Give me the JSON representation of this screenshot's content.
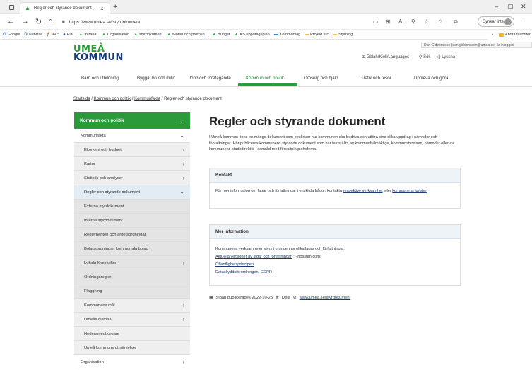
{
  "browser": {
    "tab_title": "Regler och styrande dokument -",
    "tab_close": "×",
    "new_tab": "+",
    "url": "https://www.umea.se/styrdokument",
    "sync_label": "Synkar inte",
    "more": "···",
    "win_min": "–",
    "win_restore": "▢",
    "win_close": "✕"
  },
  "bookmarks": {
    "items": [
      {
        "icon": "G",
        "label": "Google",
        "color": "#4285f4"
      },
      {
        "icon": "D",
        "label": "Netwise",
        "color": "#1565c0"
      },
      {
        "icon": "ƒ",
        "label": "360°",
        "color": "#e65100"
      },
      {
        "icon": "●",
        "label": "EDL",
        "color": "#1565c0"
      },
      {
        "icon": "▲",
        "label": "Intranät",
        "color": "#2b9a3a"
      },
      {
        "icon": "▲",
        "label": "Organisation",
        "color": "#2b9a3a"
      },
      {
        "icon": "▲",
        "label": "styrdokument",
        "color": "#2b9a3a"
      },
      {
        "icon": "▲",
        "label": "Möten och protoko...",
        "color": "#2b9a3a"
      },
      {
        "icon": "▲",
        "label": "Budget",
        "color": "#2b9a3a"
      },
      {
        "icon": "▲",
        "label": "KS uppdragsplan",
        "color": "#2b9a3a"
      },
      {
        "icon": "▬",
        "label": "Kommunlag",
        "color": "#1565c0"
      },
      {
        "icon": "▬",
        "label": "Projekt etc",
        "color": "#e8b829"
      },
      {
        "icon": "▬",
        "label": "Styrning",
        "color": "#e8b829"
      }
    ],
    "other": "Andra favoriter"
  },
  "header": {
    "logo_line1": "UMEÅ",
    "logo_line2": "KOMMUN",
    "tooltip": "Dan Gideonsson (dan.gideonsson@umea.se) är inloggad",
    "language": "Gàlàh/Kieli/Languages",
    "search": "Sök",
    "listen": "Lyssna"
  },
  "mainnav": {
    "items": [
      "Barn och utbildning",
      "Bygga, bo och miljö",
      "Jobb och företagande",
      "Kommun och politik",
      "Omsorg och hjälp",
      "Trafik och resor",
      "Uppleva och göra"
    ],
    "active_index": 3
  },
  "breadcrumb": {
    "home": "Startsida",
    "sep": "/",
    "level1": "Kommun och politik",
    "level2": "Kommunfakta",
    "current": "Regler och styrande dokument"
  },
  "sidemenu": {
    "header": "Kommun och politik",
    "items": [
      {
        "label": "Kommunfakta",
        "chevron": "⌄"
      },
      {
        "label": "Ekonomi och budget",
        "chevron": "›"
      },
      {
        "label": "Kartor",
        "chevron": "›"
      },
      {
        "label": "Statistik och analyser",
        "chevron": "›"
      },
      {
        "label": "Regler och styrande dokument",
        "chevron": "⌄"
      },
      {
        "label": "Externa styrdokument",
        "chevron": ""
      },
      {
        "label": "Interna styrdokument",
        "chevron": ""
      },
      {
        "label": "Reglementen och arbetsordningar",
        "chevron": ""
      },
      {
        "label": "Bolagsordningar, kommunala bolag",
        "chevron": ""
      },
      {
        "label": "Lokala föreskrifter",
        "chevron": "›"
      },
      {
        "label": "Ordningsregler",
        "chevron": ""
      },
      {
        "label": "Flaggning",
        "chevron": ""
      },
      {
        "label": "Kommunens mål",
        "chevron": "›"
      },
      {
        "label": "Umeås historia",
        "chevron": "›"
      },
      {
        "label": "Hedersmedborgare",
        "chevron": ""
      },
      {
        "label": "Umeå kommuns utmärkelser",
        "chevron": ""
      },
      {
        "label": "Organisation",
        "chevron": "›"
      }
    ]
  },
  "main": {
    "title": "Regler och styrande dokument",
    "intro": "I Umeå kommun finns en mängd dokument som beskriver hur kommunen ska bedriva och utföra sina olika uppdrag i nämnder och förvaltningar. Här publiceras kommunens styrande dokument som har fastställts av kommunfullmäktige, kommunstyrelsen, nämnder eller av kommunens stadsdirektör i samråd med förvaltningscheferna.",
    "contact": {
      "heading": "Kontakt",
      "text_before": "För mer information om lagar och författningar i enskilda frågor, kontakta ",
      "link1": "respektive verksamhet",
      "text_mid": " eller ",
      "link2": "kommunens jurister",
      "text_after": "."
    },
    "more_info": {
      "heading": "Mer information",
      "text": "Kommunens verksamheter styrs i grunden av olika lagar och författningar.",
      "links": [
        {
          "label": "Aktuella versioner av lagar och författningar",
          "suffix": " (notisum.com)"
        },
        {
          "label": "Offentlighetsprincipen",
          "suffix": ""
        },
        {
          "label": "Dataskyddsförordningen, GDPR",
          "suffix": ""
        }
      ]
    },
    "published": "Sidan publicerades 2022-10-25",
    "share": "Dela",
    "page_url": "www.umea.se/styrdokument"
  }
}
